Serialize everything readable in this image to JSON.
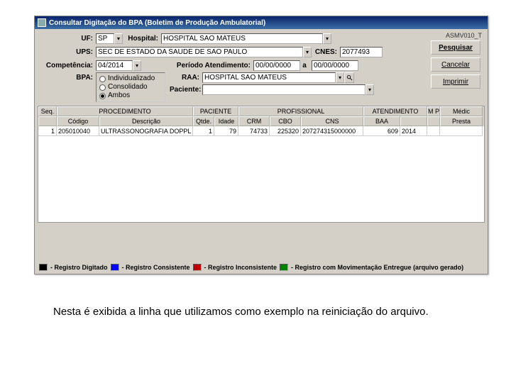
{
  "window": {
    "title": "Consultar Digitação do BPA (Boletim de Produção Ambulatorial)",
    "version": "ASMV010_T"
  },
  "labels": {
    "uf": "UF:",
    "hospital": "Hospital:",
    "ups": "UPS:",
    "cnes": "CNES:",
    "competencia": "Competência:",
    "periodo": "Período Atendimento:",
    "a": "a",
    "bpa": "BPA:",
    "raa": "RAA:",
    "paciente": "Paciente:"
  },
  "values": {
    "uf": "SP",
    "hospital": "HOSPITAL SAO MATEUS",
    "ups": "SEC DE ESTADO DA SAUDE DE SAO PAULO",
    "cnes": "2077493",
    "competencia": "04/2014",
    "periodo_de": "00/00/0000",
    "periodo_a": "00/00/0000",
    "raa": "HOSPITAL SAO MATEUS",
    "paciente": ""
  },
  "radios": {
    "r1": "Individualizado",
    "r2": "Consolidado",
    "r3": "Ambos"
  },
  "buttons": {
    "pesquisar": "Pesquisar",
    "cancelar": "Cancelar",
    "imprimir": "Imprimir"
  },
  "grid": {
    "group_headers": {
      "seq": "Seq.",
      "procedimento": "PROCEDIMENTO",
      "paciente": "PACIENTE",
      "profissional": "PROFISSIONAL",
      "atendimento": "ATENDIMENTO",
      "mp": "M P",
      "medic": "Médic"
    },
    "headers": {
      "codigo": "Código",
      "descricao": "Descrição",
      "qtde": "Qtde.",
      "idade": "Idade",
      "crm": "CRM",
      "cbo": "CBO",
      "cns": "CNS",
      "baa": "BAA",
      "blank": "",
      "prest": "Presta"
    },
    "row": {
      "seq": "1",
      "codigo": "205010040",
      "descricao": "ULTRASSONOGRAFIA DOPPL",
      "qtde": "1",
      "idade": "79",
      "crm": "74733",
      "cbo": "225320",
      "cns": "207274315000000",
      "baa": "609",
      "ano": "2014"
    }
  },
  "legend": {
    "l1": "- Registro Digitado",
    "l2": "- Registro Consistente",
    "l3": "- Registro Inconsistente",
    "l4": "- Registro com Movimentação Entregue (arquivo gerado)"
  },
  "caption": "Nesta é exibida a linha que utilizamos como exemplo na reiniciação do arquivo."
}
